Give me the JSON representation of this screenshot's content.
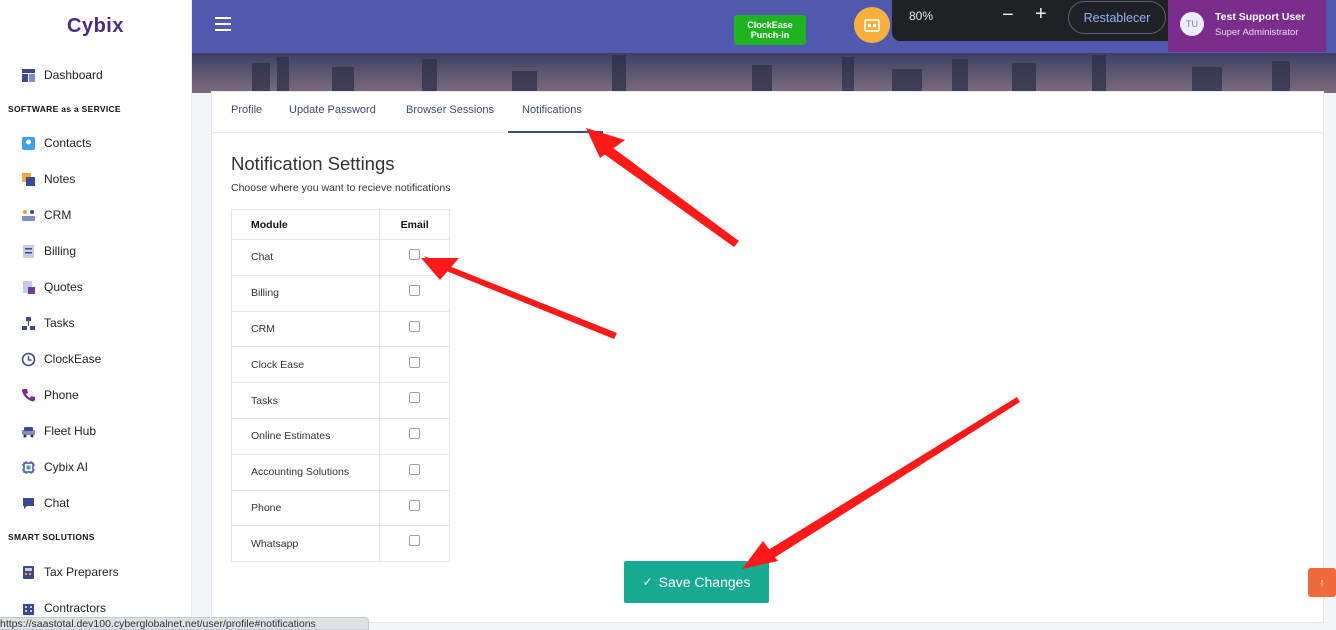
{
  "app": {
    "logo": "Cybix"
  },
  "sidebar": {
    "items": [
      {
        "label": "Dashboard",
        "icon": "dashboard-icon"
      },
      {
        "label": "Contacts",
        "icon": "contacts-icon"
      },
      {
        "label": "Notes",
        "icon": "notes-icon"
      },
      {
        "label": "CRM",
        "icon": "crm-icon"
      },
      {
        "label": "Billing",
        "icon": "billing-icon"
      },
      {
        "label": "Quotes",
        "icon": "quotes-icon"
      },
      {
        "label": "Tasks",
        "icon": "tasks-icon"
      },
      {
        "label": "ClockEase",
        "icon": "clock-icon"
      },
      {
        "label": "Phone",
        "icon": "phone-icon"
      },
      {
        "label": "Fleet Hub",
        "icon": "car-icon"
      },
      {
        "label": "Cybix AI",
        "icon": "chip-icon"
      },
      {
        "label": "Chat",
        "icon": "chat-icon"
      },
      {
        "label": "Tax Preparers",
        "icon": "calculator-icon"
      },
      {
        "label": "Contractors",
        "icon": "building-icon"
      }
    ],
    "sections": [
      "SOFTWARE as a SERVICE",
      "SMART SOLUTIONS"
    ]
  },
  "header": {
    "clockease": {
      "line1": "ClockEase",
      "line2": "Punch-in"
    },
    "user_initials": "TU",
    "user_name": "Test Support User",
    "user_role": "Super Administrator"
  },
  "zoom_popup": {
    "percent": "80%",
    "minus": "−",
    "plus": "+",
    "reset_label": "Restablecer"
  },
  "tabs": [
    {
      "label": "Profile"
    },
    {
      "label": "Update Password"
    },
    {
      "label": "Browser Sessions"
    },
    {
      "label": "Notifications"
    }
  ],
  "page": {
    "title": "Notification Settings",
    "subtitle": "Choose where you want to recieve notifications"
  },
  "table": {
    "headers": {
      "module": "Module",
      "email": "Email"
    },
    "rows": [
      {
        "module": "Chat",
        "email": false
      },
      {
        "module": "Billing",
        "email": false
      },
      {
        "module": "CRM",
        "email": false
      },
      {
        "module": "Clock Ease",
        "email": false
      },
      {
        "module": "Tasks",
        "email": false
      },
      {
        "module": "Online Estimates",
        "email": false
      },
      {
        "module": "Accounting Solutions",
        "email": false
      },
      {
        "module": "Phone",
        "email": false
      },
      {
        "module": "Whatsapp",
        "email": false
      }
    ]
  },
  "save_button": {
    "label": "Save Changes"
  },
  "status_bar": {
    "url": "https://saastotal.dev100.cyberglobalnet.net/user/profile#notifications"
  },
  "colors": {
    "header": "#5059ad",
    "accent": "#15aa91",
    "clockease": "#1fb320",
    "user_box": "#7a2d8d",
    "arrow": "#ff0000"
  }
}
